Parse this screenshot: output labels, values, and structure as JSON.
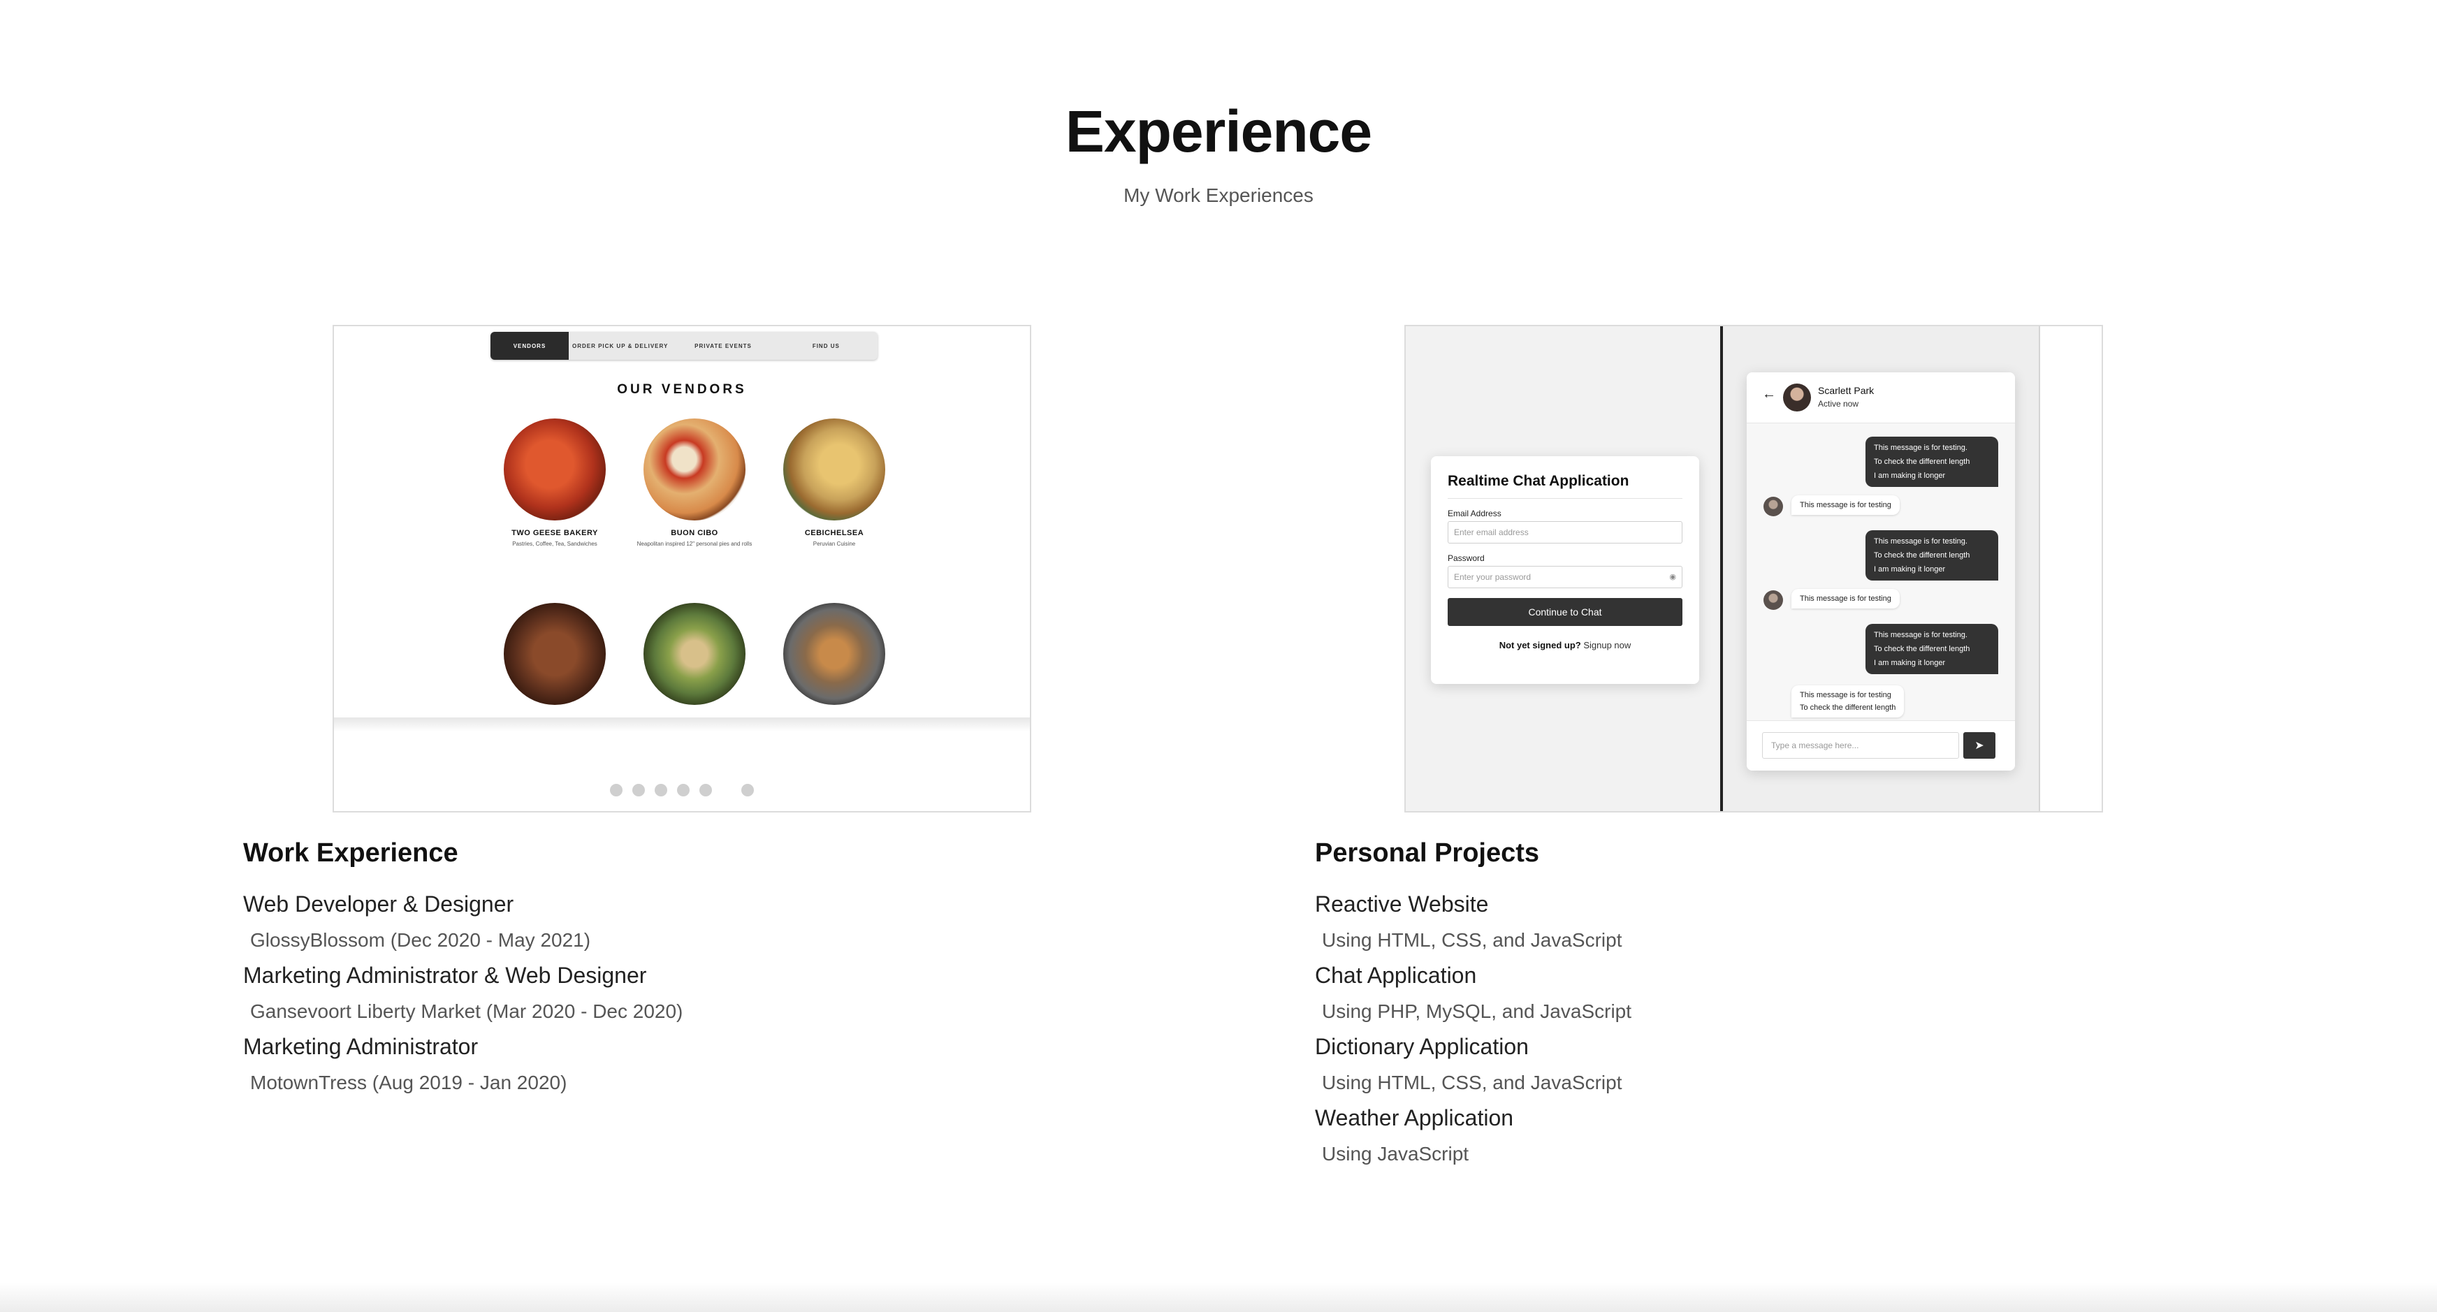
{
  "header": {
    "title": "Experience",
    "subtitle": "My Work Experiences"
  },
  "vendor_preview": {
    "nav": [
      "VENDORS",
      "ORDER PICK UP & DELIVERY",
      "PRIVATE EVENTS",
      "FIND US"
    ],
    "heading": "OUR VENDORS",
    "vendors": [
      {
        "name": "TWO GEESE BAKERY",
        "desc": "Pastries, Coffee, Tea, Sandwiches"
      },
      {
        "name": "BUON CIBO",
        "desc": "Neapolitan inspired 12\" personal pies and rolls"
      },
      {
        "name": "CEBICHELSEA",
        "desc": "Peruvian Cuisine"
      }
    ],
    "plate_colors": [
      "#b0321c",
      "#d88a4a",
      "#c8a25a",
      "#5a2e1c",
      "#5d7a3c",
      "#6b6b6b"
    ]
  },
  "chat_preview": {
    "login": {
      "title": "Realtime Chat Application",
      "email_label": "Email Address",
      "email_placeholder": "Enter email address",
      "password_label": "Password",
      "password_placeholder": "Enter your password",
      "button": "Continue to Chat",
      "signup_prompt": "Not yet signed up?",
      "signup_link": "Signup now"
    },
    "chat": {
      "user_name": "Scarlett Park",
      "user_status": "Active now",
      "outgoing": [
        [
          "This message is for testing.",
          "To check the different length",
          "I am making it longer"
        ],
        [
          "This message is for testing.",
          "To check the different length",
          "I am making it longer"
        ],
        [
          "This message is for testing.",
          "To check the different length",
          "I am making it longer"
        ]
      ],
      "incoming": [
        [
          "This message is for testing"
        ],
        [
          "This message is for testing"
        ],
        [
          "This message is for testing",
          "To check the different length"
        ]
      ],
      "input_placeholder": "Type a message here..."
    }
  },
  "work_experience": {
    "heading": "Work Experience",
    "items": [
      {
        "title": "Web Developer & Designer",
        "detail": "GlossyBlossom (Dec 2020 - May 2021)"
      },
      {
        "title": "Marketing Administrator & Web Designer",
        "detail": "Gansevoort Liberty Market (Mar 2020 - Dec 2020)"
      },
      {
        "title": "Marketing Administrator",
        "detail": "MotownTress (Aug 2019 - Jan 2020)"
      }
    ]
  },
  "personal_projects": {
    "heading": "Personal Projects",
    "items": [
      {
        "title": "Reactive Website",
        "detail": "Using HTML, CSS, and JavaScript"
      },
      {
        "title": "Chat Application",
        "detail": "Using PHP, MySQL, and JavaScript"
      },
      {
        "title": "Dictionary Application",
        "detail": "Using HTML, CSS, and JavaScript"
      },
      {
        "title": "Weather Application",
        "detail": "Using JavaScript"
      }
    ]
  }
}
